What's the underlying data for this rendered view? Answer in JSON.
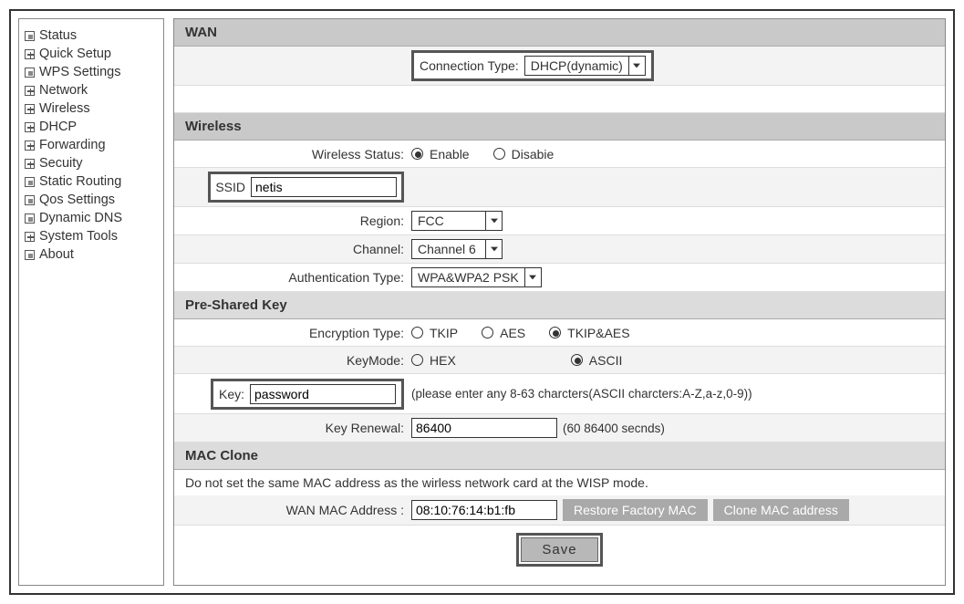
{
  "sidebar": {
    "items": [
      {
        "label": "Status",
        "icon": "dot"
      },
      {
        "label": "Quick Setup",
        "icon": "plus"
      },
      {
        "label": "WPS Settings",
        "icon": "dot"
      },
      {
        "label": "Network",
        "icon": "plus"
      },
      {
        "label": "Wireless",
        "icon": "plus"
      },
      {
        "label": "DHCP",
        "icon": "plus"
      },
      {
        "label": "Forwarding",
        "icon": "plus"
      },
      {
        "label": "Secuity",
        "icon": "plus"
      },
      {
        "label": "Static Routing",
        "icon": "dot"
      },
      {
        "label": "Qos Settings",
        "icon": "dot"
      },
      {
        "label": "Dynamic DNS",
        "icon": "dot"
      },
      {
        "label": "System Tools",
        "icon": "plus"
      },
      {
        "label": "About",
        "icon": "dot"
      }
    ]
  },
  "wan": {
    "title": "WAN",
    "connection_type_label": "Connection Type:",
    "connection_type_value": "DHCP(dynamic)"
  },
  "wireless": {
    "title": "Wireless",
    "status_label": "Wireless Status:",
    "status_options": {
      "enable": "Enable",
      "disable": "Disabie"
    },
    "status_value": "enable",
    "ssid_label": "SSID",
    "ssid_value": "netis",
    "region_label": "Region:",
    "region_value": "FCC",
    "channel_label": "Channel:",
    "channel_value": "Channel 6",
    "auth_label": "Authentication Type:",
    "auth_value": "WPA&WPA2 PSK"
  },
  "psk": {
    "title": "Pre-Shared Key",
    "encryption_label": "Encryption Type:",
    "encryption_options": {
      "tkip": "TKIP",
      "aes": "AES",
      "both": "TKIP&AES"
    },
    "encryption_value": "both",
    "keymode_label": "KeyMode:",
    "keymode_options": {
      "hex": "HEX",
      "ascii": "ASCII"
    },
    "keymode_value": "ascii",
    "key_label": "Key:",
    "key_value": "password",
    "key_hint": "(please enter any 8-63 charcters(ASCII charcters:A-Z,a-z,0-9))",
    "renewal_label": "Key Renewal:",
    "renewal_value": "86400",
    "renewal_hint": "(60 86400 secnds)"
  },
  "mac": {
    "title": "MAC Clone",
    "note": "Do not set the same MAC address as the wirless network card at the WISP mode.",
    "wan_mac_label": "WAN MAC Address :",
    "wan_mac_value": "08:10:76:14:b1:fb",
    "restore_btn": "Restore Factory MAC",
    "clone_btn": "Clone MAC address"
  },
  "save_label": "Save"
}
